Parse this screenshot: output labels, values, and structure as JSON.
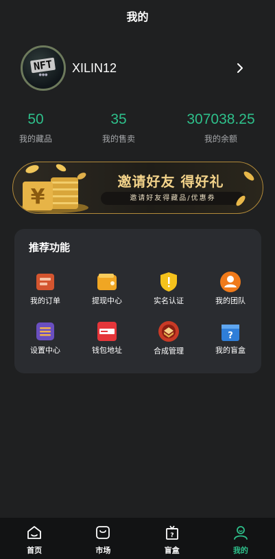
{
  "header": {
    "title": "我的"
  },
  "profile": {
    "username": "XILIN12",
    "avatar_text": "NFT",
    "avatar_icon": "nft-avatar-icon"
  },
  "stats": [
    {
      "value": "50",
      "label": "我的藏品"
    },
    {
      "value": "35",
      "label": "我的售卖"
    },
    {
      "value": "307038.25",
      "label": "我的余额"
    }
  ],
  "banner": {
    "title": "邀请好友  得好礼",
    "subtitle": "邀请好友得藏品/优惠券"
  },
  "features": {
    "title": "推荐功能",
    "items": [
      {
        "label": "我的订单",
        "icon": "order-icon"
      },
      {
        "label": "提现中心",
        "icon": "wallet-icon"
      },
      {
        "label": "实名认证",
        "icon": "shield-icon"
      },
      {
        "label": "我的团队",
        "icon": "team-icon"
      },
      {
        "label": "设置中心",
        "icon": "settings-icon"
      },
      {
        "label": "钱包地址",
        "icon": "card-icon"
      },
      {
        "label": "合成管理",
        "icon": "synthesis-icon"
      },
      {
        "label": "我的盲盒",
        "icon": "mystery-box-icon"
      }
    ]
  },
  "tabbar": {
    "items": [
      {
        "label": "首页",
        "icon": "home-icon"
      },
      {
        "label": "市场",
        "icon": "market-icon"
      },
      {
        "label": "盲盒",
        "icon": "blind-box-icon"
      },
      {
        "label": "我的",
        "icon": "user-icon"
      }
    ],
    "active_index": 3
  },
  "colors": {
    "accent": "#2ec08b",
    "background": "#1f2021",
    "card": "#2a2c30",
    "gold": "#f3d38a"
  }
}
